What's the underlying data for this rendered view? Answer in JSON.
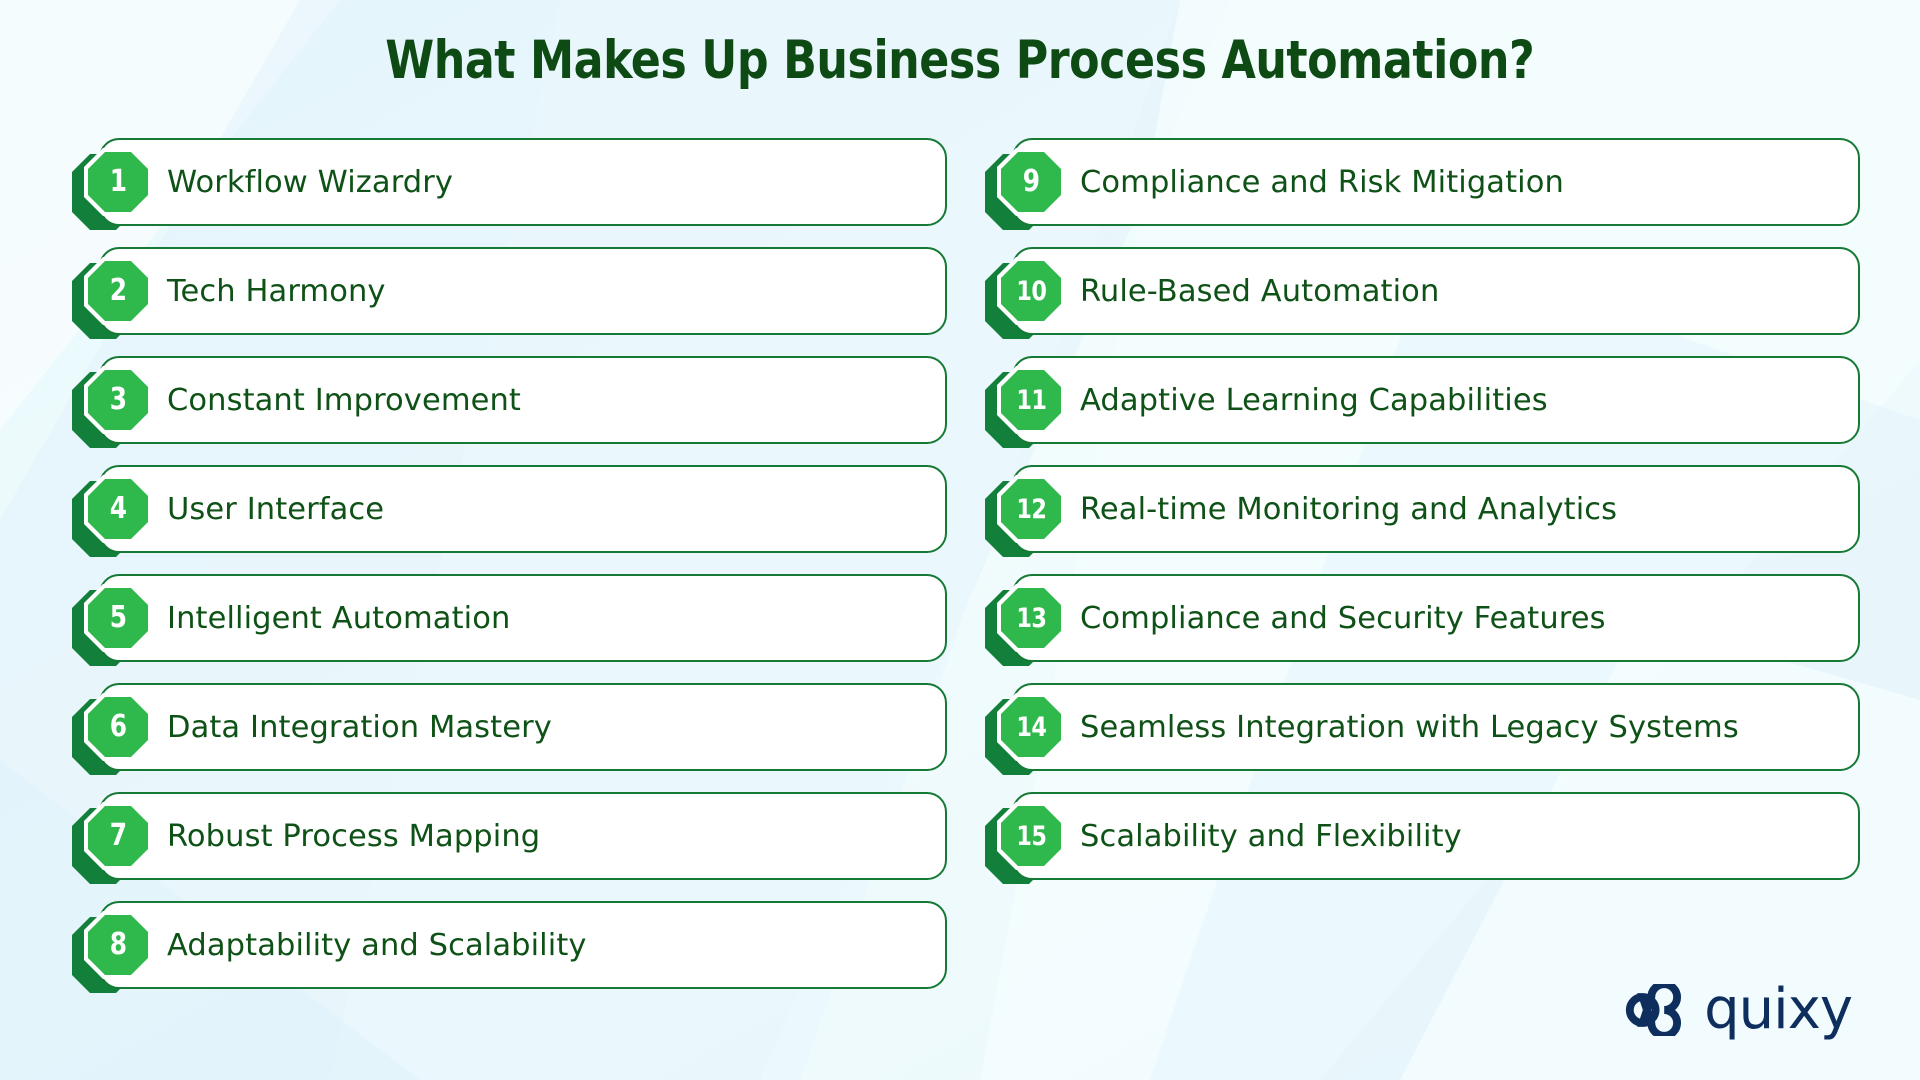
{
  "page": {
    "title": "What Makes Up Business Process Automation?",
    "background_color": "#edfbfc",
    "accent_green": "#2fb84c",
    "dark_green": "#12803a",
    "text_green": "#0f5217",
    "title_green": "#0d4a14",
    "card_border": "#167a36",
    "logo_navy": "#0e2f5e"
  },
  "left_column": [
    {
      "number": "1",
      "label": "Workflow Wizardry"
    },
    {
      "number": "2",
      "label": "Tech Harmony"
    },
    {
      "number": "3",
      "label": "Constant Improvement"
    },
    {
      "number": "4",
      "label": "User Interface"
    },
    {
      "number": "5",
      "label": "Intelligent Automation"
    },
    {
      "number": "6",
      "label": "Data Integration Mastery"
    },
    {
      "number": "7",
      "label": "Robust Process Mapping"
    },
    {
      "number": "8",
      "label": "Adaptability and Scalability"
    }
  ],
  "right_column": [
    {
      "number": "9",
      "label": "Compliance and Risk Mitigation"
    },
    {
      "number": "10",
      "label": "Rule-Based Automation"
    },
    {
      "number": "11",
      "label": "Adaptive Learning Capabilities"
    },
    {
      "number": "12",
      "label": "Real-time Monitoring and Analytics"
    },
    {
      "number": "13",
      "label": "Compliance and Security Features"
    },
    {
      "number": "14",
      "label": "Seamless Integration with Legacy Systems"
    },
    {
      "number": "15",
      "label": "Scalability and Flexibility"
    }
  ],
  "logo": {
    "wordmark": "quixy",
    "mark_name": "quixy-infinity-logo"
  }
}
